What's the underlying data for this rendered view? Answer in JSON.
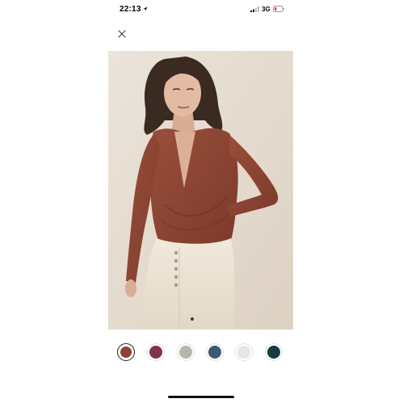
{
  "status_bar": {
    "time": "22:13",
    "location_icon": "location-arrow-icon",
    "signal_icon": "cellular-signal-icon",
    "network": "3G",
    "battery_icon": "battery-low-icon",
    "battery_color": "#e8463c"
  },
  "header": {
    "close_icon": "close-icon"
  },
  "product": {
    "image_colors": {
      "background": "#e6ddd2",
      "top": "#8c4433",
      "pants": "#ece3d4",
      "hair": "#3a2a22",
      "skin": "#e0b79f"
    }
  },
  "swatches": [
    {
      "color": "#8d4434",
      "selected": true
    },
    {
      "color": "#80344a",
      "selected": false
    },
    {
      "color": "#b7b5ad",
      "selected": false
    },
    {
      "color": "#3e5a73",
      "selected": false
    },
    {
      "color": "#e9e4e1",
      "selected": false
    },
    {
      "color": "#163c40",
      "selected": false
    }
  ]
}
